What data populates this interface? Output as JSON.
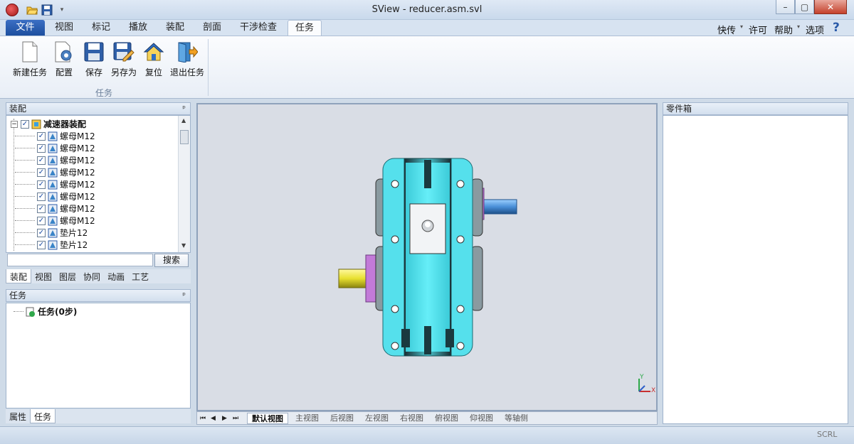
{
  "window": {
    "title": "SView - reducer.asm.svl"
  },
  "ribbon_tabs": [
    "文件",
    "视图",
    "标记",
    "播放",
    "装配",
    "剖面",
    "干涉检查",
    "任务"
  ],
  "right_menu": [
    "快传",
    "许可",
    "帮助",
    "选项"
  ],
  "help_glyph": "?",
  "ribbon": {
    "buttons": [
      {
        "label": "新建任务",
        "icon": "new-document-icon"
      },
      {
        "label": "配置",
        "icon": "configure-gear-icon"
      },
      {
        "label": "保存",
        "icon": "floppy-save-icon"
      },
      {
        "label": "另存为",
        "icon": "save-as-icon"
      },
      {
        "label": "复位",
        "icon": "home-reset-icon"
      },
      {
        "label": "退出任务",
        "icon": "exit-door-icon"
      }
    ],
    "group_label": "任务"
  },
  "assembly_panel": {
    "title": "装配",
    "pin": "ᵖ",
    "root": "减速器装配",
    "items": [
      "螺母M12",
      "螺母M12",
      "螺母M12",
      "螺母M12",
      "螺母M12",
      "螺母M12",
      "螺母M12",
      "螺母M12",
      "垫片12",
      "垫片12"
    ],
    "search_placeholder": "",
    "search_button": "搜索",
    "bottom_tabs": [
      "装配",
      "视图",
      "图层",
      "协同",
      "动画",
      "工艺"
    ]
  },
  "task_panel": {
    "title": "任务",
    "pin": "ᵖ",
    "root": "任务(0步)",
    "bottom_tabs": [
      "属性",
      "任务"
    ]
  },
  "parts_panel": {
    "title": "零件箱"
  },
  "view_tabs": [
    "默认视图",
    "主视图",
    "后视图",
    "左视图",
    "右视图",
    "俯视图",
    "仰视图",
    "等轴侧"
  ],
  "view_nav": [
    "⏮",
    "◀",
    "▶",
    "⏭"
  ],
  "axes": {
    "x": "X",
    "y": "Y"
  },
  "status": {
    "scrl": "SCRL"
  },
  "colors": {
    "model_body": "#55e0ec",
    "shaft_blue": "#4a8fd8",
    "shaft_yellow": "#e8e030",
    "accent": "#1d4f9f"
  }
}
